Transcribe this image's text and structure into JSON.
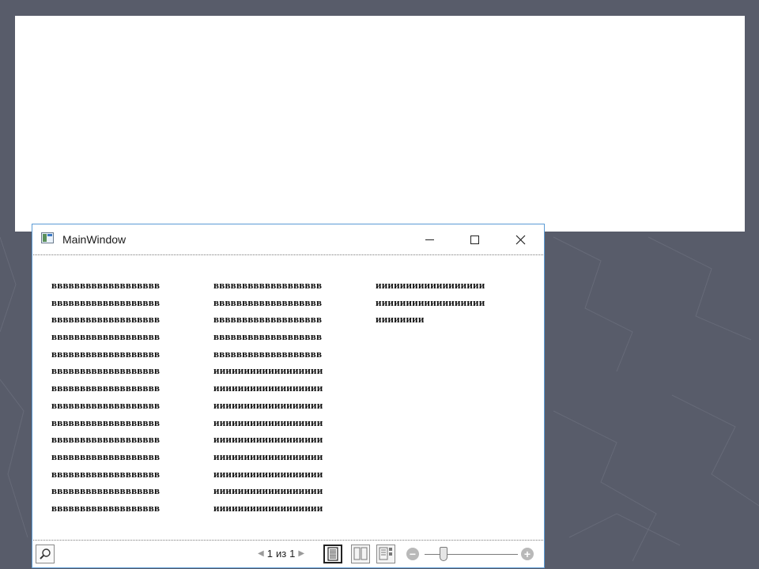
{
  "window": {
    "title": "MainWindow",
    "minimize_label": "–",
    "maximize_label": "☐",
    "close_label": "✕"
  },
  "document": {
    "columns": [
      [
        "ввввввввввввввввввв",
        "ввввввввввввввввввв",
        "ввввввввввввввввввв",
        "ввввввввввввввввввв",
        "ввввввввввввввввввв",
        "ввввввввввввввввввв",
        "ввввввввввввввввввв",
        "ввввввввввввввввввв",
        "ввввввввввввввввввв",
        "ввввввввввввввввввв",
        "ввввввввввввввввввв",
        "ввввввввввввввввввв",
        "ввввввввввввввввввв",
        "ввввввввввввввввввв"
      ],
      [
        "ввввввввввввввввввв",
        "ввввввввввввввввввв",
        "ввввввввввввввввввв",
        "ввввввввввввввввввв",
        "ввввввввввввввввввв",
        "ииииииииииииииииии",
        "ииииииииииииииииии",
        "ииииииииииииииииии",
        "ииииииииииииииииии",
        "ииииииииииииииииии",
        "ииииииииииииииииии",
        "ииииииииииииииииии",
        "ииииииииииииииииии",
        "ииииииииииииииииии"
      ],
      [
        "ииииииииииииииииии",
        "ииииииииииииииииии",
        "ииииииии"
      ]
    ]
  },
  "toolbar": {
    "find_icon": "search-icon",
    "page_current": "1",
    "page_separator": "из",
    "page_total": "1",
    "view_modes": [
      "single-page",
      "two-page",
      "page-thumbnail"
    ],
    "active_view": "single-page",
    "zoom_level": 0.2
  }
}
